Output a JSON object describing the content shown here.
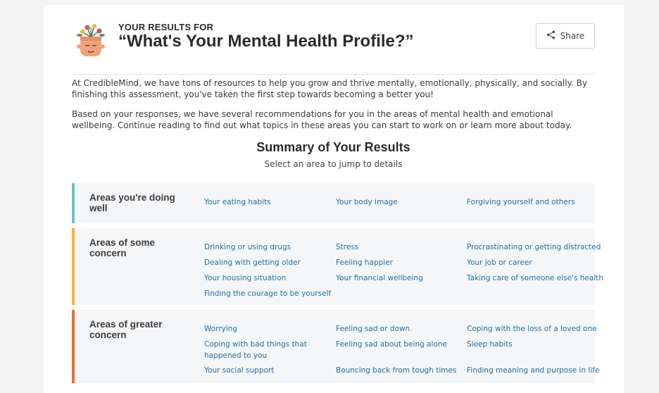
{
  "header": {
    "subtitle": "YOUR RESULTS FOR",
    "title": "“What's Your Mental Health Profile?”",
    "share_label": "Share"
  },
  "intro": {
    "p1": "At CredibleMind, we have tons of resources to help you grow and thrive mentally, emotionally, physically, and socially. By finishing this assessment, you've taken the first step towards becoming a better you!",
    "p2": "Based on your responses, we have several recommendations for you in the areas of mental health and emotional wellbeing. Continue reading to find out what topics in these areas you can start to work on or learn more about today."
  },
  "summary": {
    "title": "Summary of Your Results",
    "subtitle": "Select an area to jump to details"
  },
  "areas": {
    "well": {
      "label": "Areas you're doing well",
      "color": "#6cc4b9",
      "items": [
        "Your eating habits",
        "Your body image",
        "Forgiving yourself and others"
      ]
    },
    "some": {
      "label": "Areas of some concern",
      "color": "#f6b52f",
      "items": [
        "Drinking or using drugs",
        "Stress",
        "Procrastinating or getting distracted",
        "Dealing with getting older",
        "Feeling happier",
        "Your job or career",
        "Your housing situation",
        "Your financial wellbeing",
        "Taking care of someone else's health",
        "Finding the courage to be yourself"
      ]
    },
    "greater": {
      "label": "Areas of greater concern",
      "color": "#e8702d",
      "items": [
        "Worrying",
        "Feeling sad or down",
        "Coping with the loss of a loved one",
        "Coping with bad things that happened to you",
        "Feeling sad about being alone",
        "Sleep habits",
        "Your social support",
        "Bouncing back from tough times",
        "Finding meaning and purpose in life"
      ]
    }
  },
  "icons": {
    "share": "share-icon",
    "avatar": "head-with-flowers-avatar"
  }
}
